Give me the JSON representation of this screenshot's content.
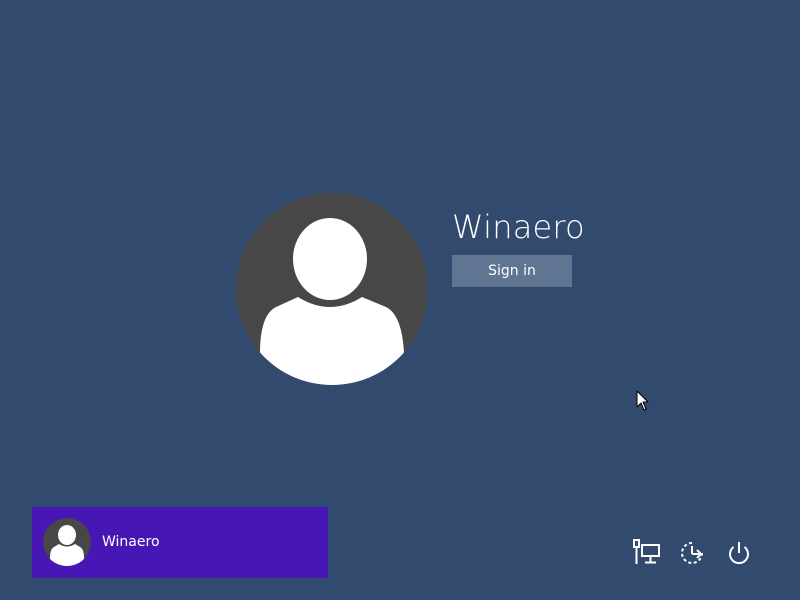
{
  "user": {
    "name": "Winaero",
    "sign_in_label": "Sign in"
  },
  "user_tiles": [
    {
      "name": "Winaero"
    }
  ],
  "system_icons": [
    "network-icon",
    "ease-of-access-icon",
    "power-icon"
  ],
  "colors": {
    "background": "#314a6e",
    "avatar_bg": "#474747",
    "sign_in_button": "#5f7592",
    "user_tile_bg": "#4617b4"
  }
}
